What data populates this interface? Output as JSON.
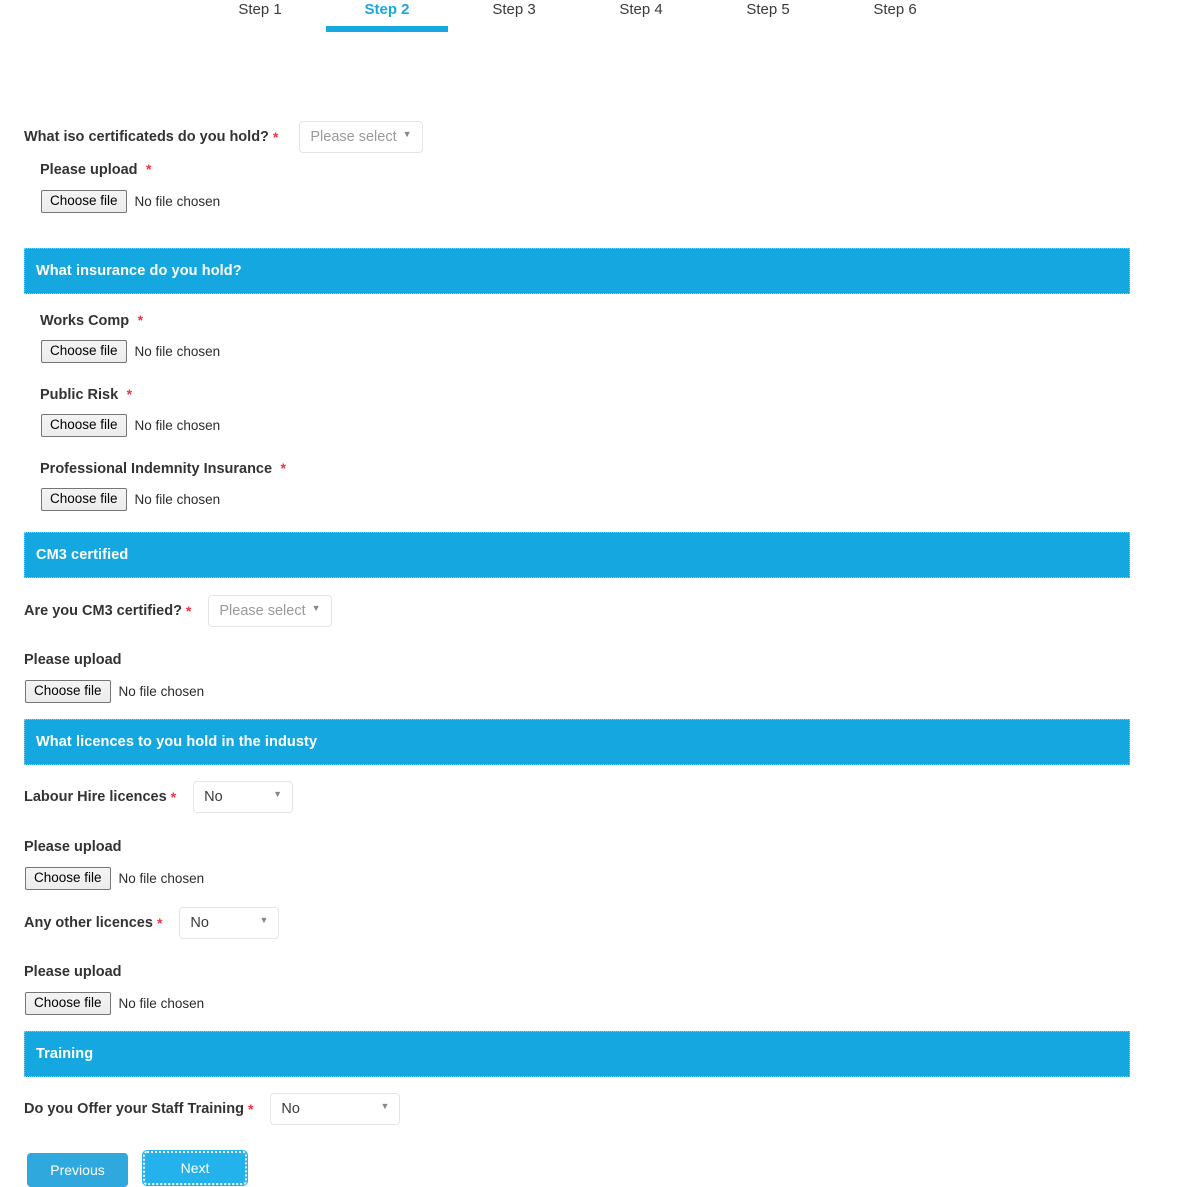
{
  "stepper": {
    "steps": [
      {
        "label": "Step 1",
        "active": false
      },
      {
        "label": "Step 2",
        "active": true
      },
      {
        "label": "Step 3",
        "active": false
      },
      {
        "label": "Step 4",
        "active": false
      },
      {
        "label": "Step 5",
        "active": false
      },
      {
        "label": "Step 6",
        "active": false
      }
    ]
  },
  "file_input": {
    "button_label": "Choose file",
    "no_file_text": "No file chosen"
  },
  "select_placeholder": "Please select",
  "iso": {
    "question": "What iso certificateds do you hold?",
    "required_marker": "*",
    "select_value": "Please select",
    "upload_label": "Please upload",
    "upload_required_marker": "*"
  },
  "insurance": {
    "section_title": "What insurance do you hold?",
    "fields": [
      {
        "label": "Works Comp",
        "required_marker": "*"
      },
      {
        "label": "Public Risk",
        "required_marker": "*"
      },
      {
        "label": "Professional Indemnity Insurance",
        "required_marker": "*"
      }
    ]
  },
  "cm3": {
    "section_title": "CM3 certified",
    "question": "Are you CM3 certified?",
    "required_marker": "*",
    "select_value": "Please select",
    "upload_label": "Please upload"
  },
  "licences": {
    "section_title": "What licences to you hold in the industy",
    "labour_hire": {
      "label": "Labour Hire licences",
      "required_marker": "*",
      "select_value": "No",
      "upload_label": "Please upload"
    },
    "any_other": {
      "label": "Any other licences",
      "required_marker": "*",
      "select_value": "No",
      "upload_label": "Please upload"
    }
  },
  "training": {
    "section_title": "Training",
    "question": "Do you Offer your Staff Training",
    "required_marker": "*",
    "select_value": "No"
  },
  "footer": {
    "previous_label": "Previous",
    "next_label": "Next"
  },
  "colors": {
    "accent_blue": "#15a8e0",
    "required_red": "#f5333f",
    "section_text": "#ffffff"
  }
}
